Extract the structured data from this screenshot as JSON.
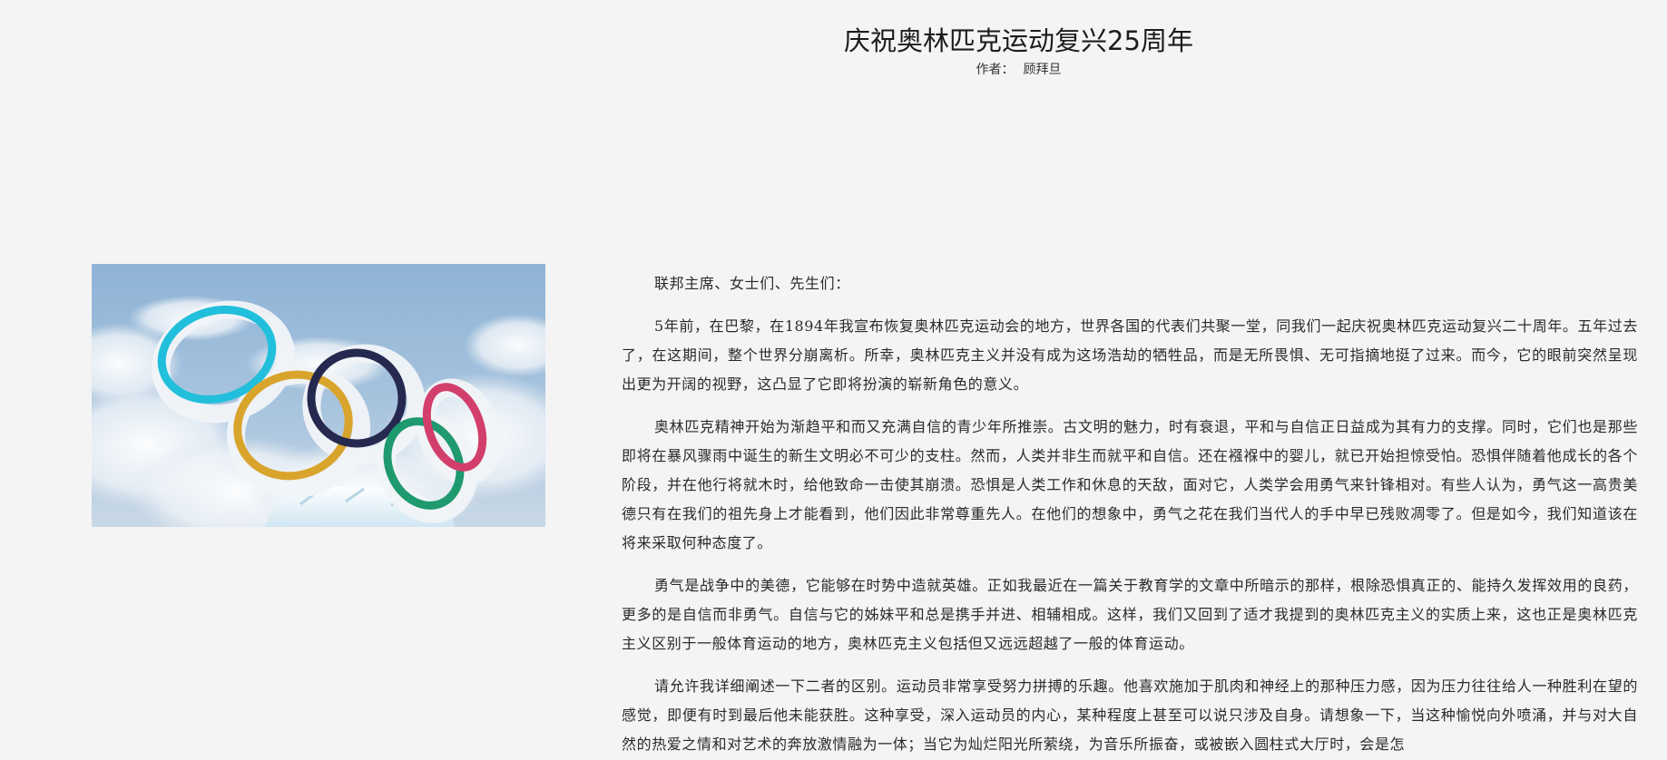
{
  "article": {
    "title": "庆祝奥林匹克运动复兴25周年",
    "author_label": "作者：",
    "author_name": "顾拜旦",
    "image": {
      "icon": "olympic-rings-photo",
      "ring_colors": [
        "#22bfdc",
        "#d9a42c",
        "#26294f",
        "#1f9a6e",
        "#d23f6c"
      ]
    },
    "paragraphs": [
      "联邦主席、女士们、先生们：",
      "5年前，在巴黎，在1894年我宣布恢复奥林匹克运动会的地方，世界各国的代表们共聚一堂，同我们一起庆祝奥林匹克运动复兴二十周年。五年过去了，在这期间，整个世界分崩离析。所幸，奥林匹克主义并没有成为这场浩劫的牺牲品，而是无所畏惧、无可指摘地挺了过来。而今，它的眼前突然呈现出更为开阔的视野，这凸显了它即将扮演的崭新角色的意义。",
      "奥林匹克精神开始为渐趋平和而又充满自信的青少年所推崇。古文明的魅力，时有衰退，平和与自信正日益成为其有力的支撑。同时，它们也是那些即将在暴风骤雨中诞生的新生文明必不可少的支柱。然而，人类并非生而就平和自信。还在襁褓中的婴儿，就已开始担惊受怕。恐惧伴随着他成长的各个阶段，并在他行将就木时，给他致命一击使其崩溃。恐惧是人类工作和休息的天敌，面对它，人类学会用勇气来针锋相对。有些人认为，勇气这一高贵美德只有在我们的祖先身上才能看到，他们因此非常尊重先人。在他们的想象中，勇气之花在我们当代人的手中早已残败凋零了。但是如今，我们知道该在将来采取何种态度了。",
      "勇气是战争中的美德，它能够在时势中造就英雄。正如我最近在一篇关于教育学的文章中所暗示的那样，根除恐惧真正的、能持久发挥效用的良药，更多的是自信而非勇气。自信与它的姊妹平和总是携手并进、相辅相成。这样，我们又回到了适才我提到的奥林匹克主义的实质上来，这也正是奥林匹克主义区别于一般体育运动的地方，奥林匹克主义包括但又远远超越了一般的体育运动。",
      "请允许我详细阐述一下二者的区别。运动员非常享受努力拼搏的乐趣。他喜欢施加于肌肉和神经上的那种压力感，因为压力往往给人一种胜利在望的感觉，即便有时到最后他未能获胜。这种享受，深入运动员的内心，某种程度上甚至可以说只涉及自身。请想象一下，当这种愉悦向外喷涌，并与对大自然的热爱之情和对艺术的奔放激情融为一体；当它为灿烂阳光所萦绕，为音乐所振奋，或被嵌入圆柱式大厅时，会是怎"
    ]
  }
}
